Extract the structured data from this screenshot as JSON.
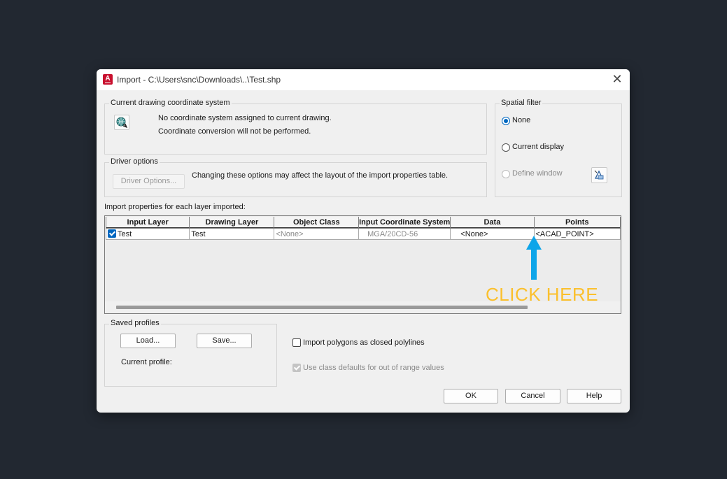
{
  "window": {
    "app_icon_letter": "A",
    "title": "Import - C:\\Users\\snc\\Downloads\\..\\Test.shp"
  },
  "coordinate_system": {
    "label": "Current drawing coordinate system",
    "line1": "No coordinate system assigned to current drawing.",
    "line2": "Coordinate conversion will not be performed."
  },
  "driver_options": {
    "label": "Driver options",
    "button": "Driver Options...",
    "note": "Changing these options may affect the layout of the import properties table."
  },
  "spatial_filter": {
    "label": "Spatial filter",
    "options": [
      {
        "label": "None",
        "checked": true,
        "enabled": true
      },
      {
        "label": "Current display",
        "checked": false,
        "enabled": true
      },
      {
        "label": "Define window",
        "checked": false,
        "enabled": false
      }
    ]
  },
  "import_properties": {
    "label": "Import properties for each layer imported:",
    "columns": [
      "Input Layer",
      "Drawing Layer",
      "Object Class",
      "Input Coordinate System",
      "Data",
      "Points"
    ],
    "rows": [
      {
        "checked": true,
        "input_layer": "Test",
        "drawing_layer": "Test",
        "object_class": "<None>",
        "coordinate_system": "MGA/20CD-56",
        "data": "<None>",
        "points": "<ACAD_POINT>"
      }
    ]
  },
  "annotation": {
    "text": "CLICK HERE",
    "color": "#fbc02d",
    "arrow_color": "#0ea5e9"
  },
  "saved_profiles": {
    "label": "Saved profiles",
    "load": "Load...",
    "save": "Save...",
    "current_profile_label": "Current profile:"
  },
  "options": {
    "polygons_label": "Import polygons as closed polylines",
    "polygons_checked": false,
    "class_defaults_label": "Use class defaults for out of range values",
    "class_defaults_checked": true
  },
  "buttons": {
    "ok": "OK",
    "cancel": "Cancel",
    "help": "Help"
  }
}
